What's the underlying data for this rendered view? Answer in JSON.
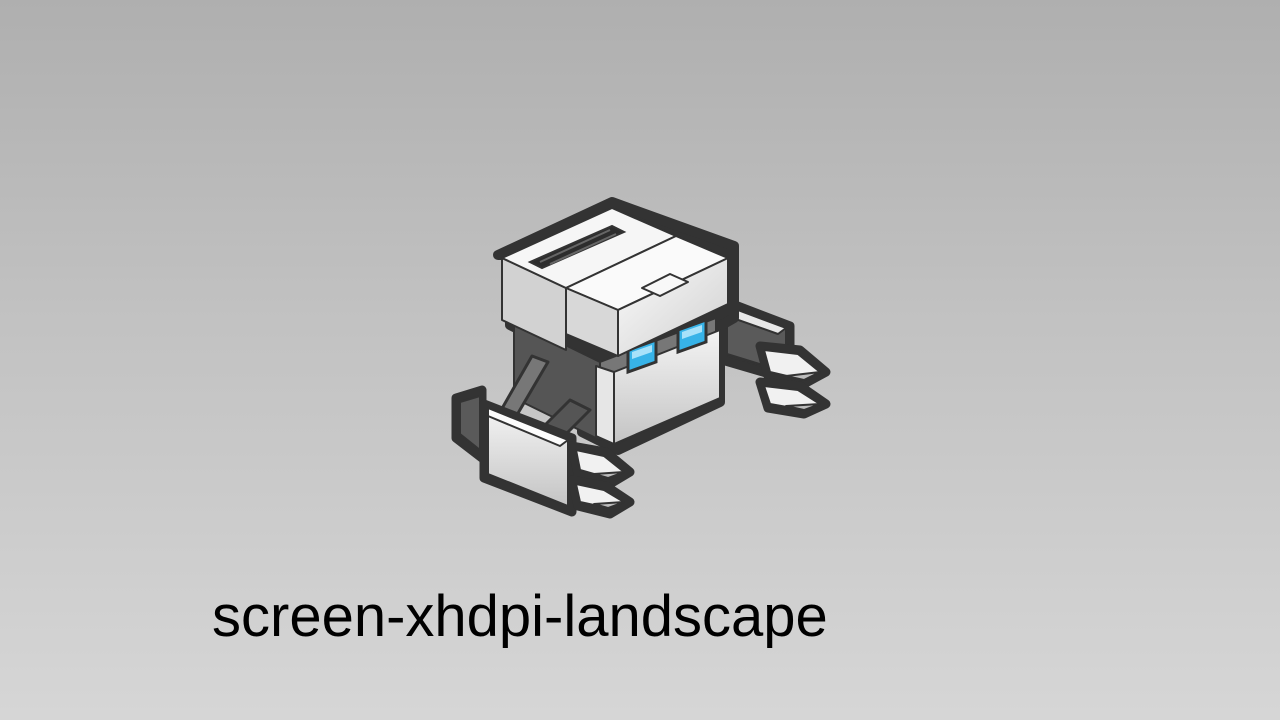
{
  "screen": {
    "caption": "screen-xhdpi-landscape",
    "logo_icon": "robot-logo-icon"
  },
  "colors": {
    "background_top": "#afafaf",
    "background_bottom": "#d6d6d6",
    "outline": "#333333",
    "body_light": "#eeeeee",
    "body_shade": "#bdbdbd",
    "dark_part": "#555555",
    "eye": "#37b3e8",
    "caption": "#000000"
  }
}
